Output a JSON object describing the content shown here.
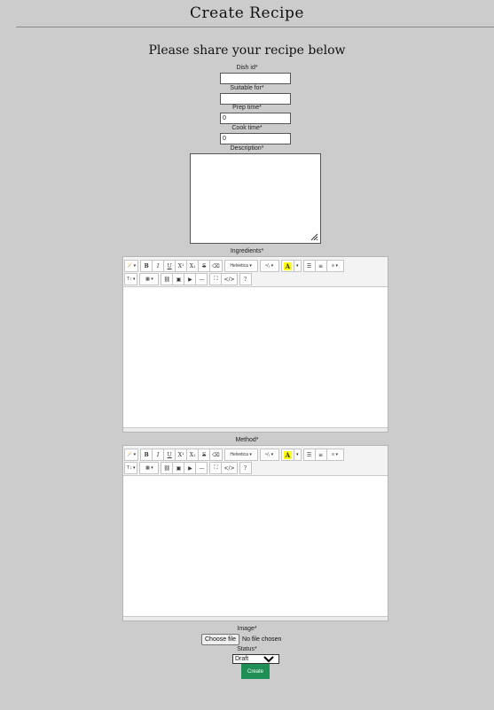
{
  "header": {
    "title": "Create Recipe"
  },
  "form": {
    "subtitle": "Please share your recipe below",
    "dish_label": "Dish id*",
    "dish_value": "",
    "suitable_label": "Suitable for*",
    "suitable_value": "",
    "prep_label": "Prep time*",
    "prep_value": "0",
    "cook_label": "Cook time*",
    "cook_value": "0",
    "description_label": "Description*",
    "ingredients_label": "Ingredients*",
    "method_label": "Method*",
    "image_label": "Image*",
    "file_button": "Choose file",
    "file_status": "No file chosen",
    "status_label": "Status*",
    "status_value": "Draft",
    "submit_label": "Create"
  },
  "toolbar": {
    "magic": "🪄 ▾",
    "bold": "B",
    "italic": "I",
    "underline": "U",
    "superscript": "X¹",
    "subscript": "X₁",
    "strikethrough": "S",
    "eraser": "⌫",
    "font": "Helvetica ▾",
    "fontsize": "⁹/₁ ▾",
    "color": "A",
    "color_caret": "▾",
    "ul": "☰",
    "ol": "≡",
    "align": "≡ ▾",
    "paragraph": "T↕ ▾",
    "table": "▦ ▾",
    "link": "⛓",
    "picture": "▣",
    "video": "▶",
    "hr": "—",
    "fullscreen": "⛶",
    "code": "</>",
    "help": "?"
  },
  "colors": {
    "background": "#cccccc",
    "create_button": "#1e8f55",
    "highlight": "#ffff00"
  }
}
